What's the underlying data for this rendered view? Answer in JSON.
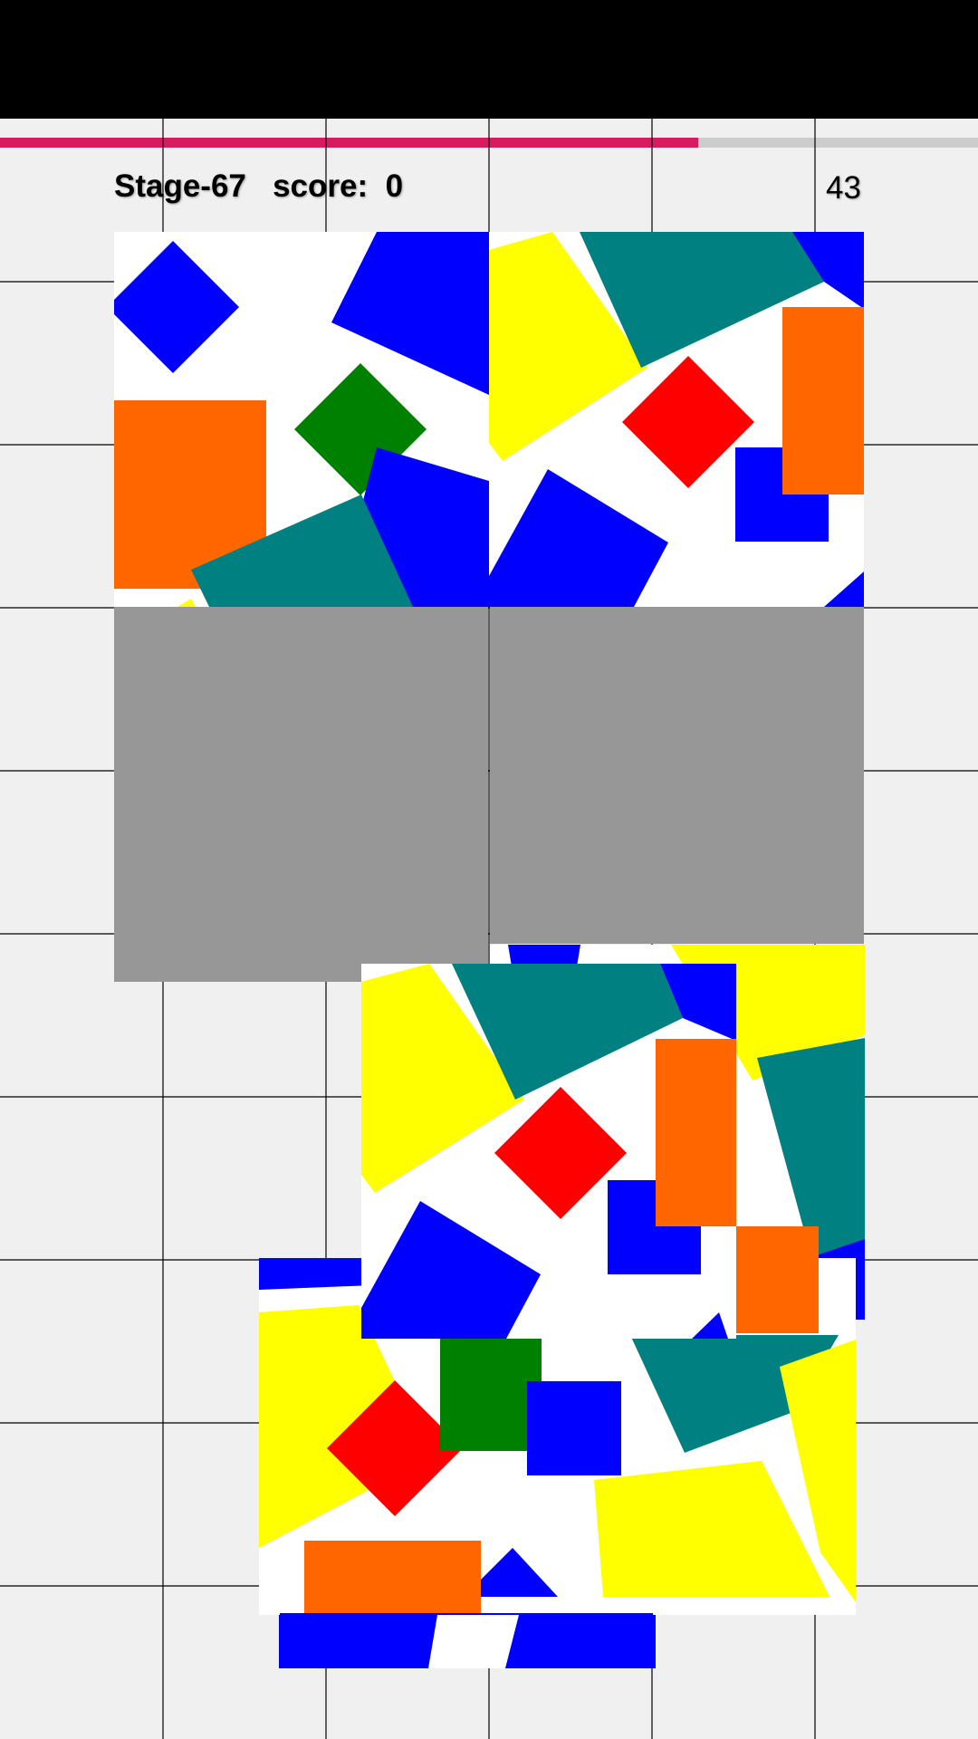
{
  "header": {
    "stage_label": "Stage-67   score:  0",
    "timer": "43"
  },
  "progress": {
    "fraction": 0.714,
    "fill_color": "#d81b60",
    "track_color": "#cccccc"
  },
  "palette": {
    "blue": "#0000ff",
    "teal": "#008080",
    "yellow": "#ffff00",
    "red": "#ff0000",
    "green": "#008000",
    "orange": "#ff6600",
    "empty_slot": "#979797",
    "background": "#f0f0f0"
  },
  "board": {
    "placed_tiles": [
      "tile-top-left",
      "tile-top-right"
    ],
    "empty_slots": [
      "slot-bottom-left",
      "slot-bottom-right"
    ]
  },
  "loose_pieces": [
    "piece-1",
    "piece-2",
    "piece-3"
  ]
}
